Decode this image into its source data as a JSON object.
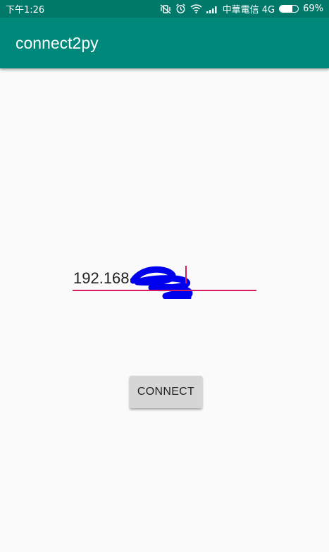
{
  "status_bar": {
    "time": "下午1:26",
    "carrier": "中華電信 4G",
    "battery_percent": "69%",
    "battery_level": 0.69,
    "icons": [
      "mute-vibrate-icon",
      "alarm-icon",
      "wifi-icon",
      "signal-icon",
      "battery-icon"
    ]
  },
  "app_bar": {
    "title": "connect2py",
    "color": "#00897b"
  },
  "ip_input": {
    "value": "192.168",
    "accent_color": "#d81b60"
  },
  "connect_button": {
    "label": "CONNECT"
  }
}
